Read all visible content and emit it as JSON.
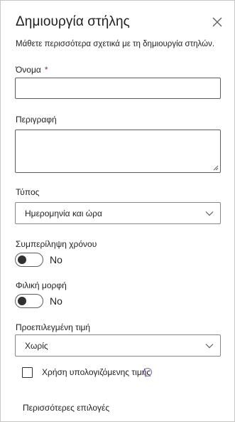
{
  "panel": {
    "title": "Δημιουργία στήλης",
    "learn_more": "Μάθετε περισσότερα σχετικά με τη δημιουργία στηλών."
  },
  "fields": {
    "name_label": "Όνομα",
    "required_mark": "*",
    "name_value": "",
    "description_label": "Περιγραφή",
    "description_value": "",
    "type_label": "Τύπος",
    "type_value": "Ημερομηνία και ώρα",
    "include_time_label": "Συμπερίληψη χρόνου",
    "include_time_state": "No",
    "friendly_format_label": "Φιλική μορφή",
    "friendly_format_state": "No",
    "default_value_label": "Προεπιλεγμένη τιμή",
    "default_value_value": "Χωρίς",
    "calculated_value_label": "Χρήση υπολογιζόμενης τιμής",
    "more_options": "Περισσότερες επιλογές"
  },
  "icons": {
    "close": "close-icon",
    "chevron": "chevron-down-icon",
    "info": "info-icon"
  },
  "colors": {
    "required": "#a4262c",
    "info_ring": "#8764b8",
    "border": "#605e5c"
  }
}
